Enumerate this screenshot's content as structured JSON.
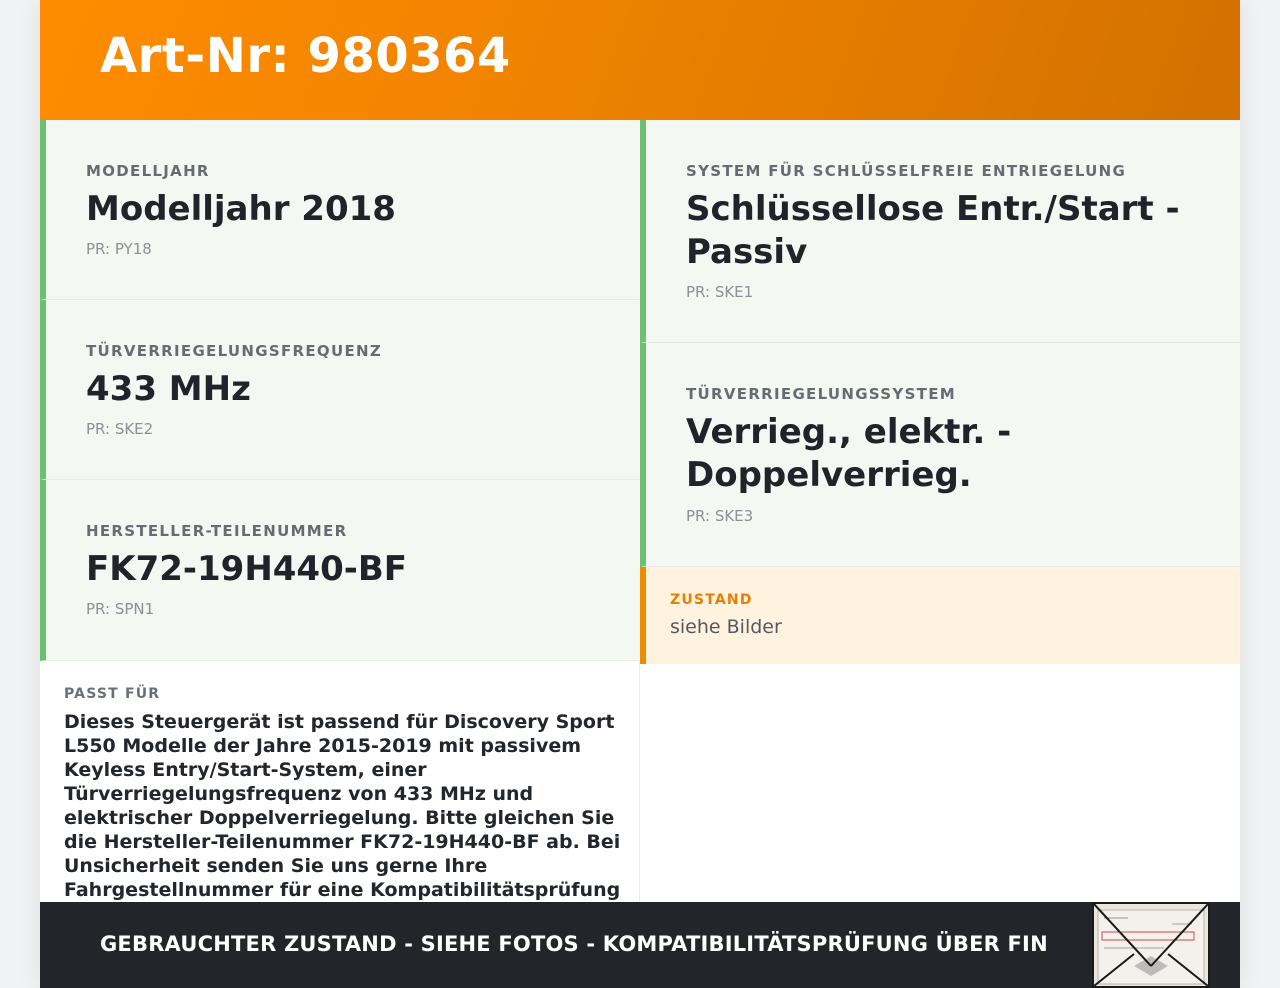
{
  "header": {
    "title": "Art-Nr: 980364"
  },
  "specs_left": [
    {
      "label": "Modelljahr",
      "value": "Modelljahr 2018",
      "pr": "PR: PY18"
    },
    {
      "label": "Türverriegelungsfrequenz",
      "value": "433 MHz",
      "pr": "PR: SKE2"
    },
    {
      "label": "Hersteller-Teilenummer",
      "value": "FK72-19H440-BF",
      "pr": "PR: SPN1"
    }
  ],
  "specs_right": [
    {
      "label": "System für schlüsselfreie Entriegelung",
      "value": "Schlüssellose Entr./Start - Passiv",
      "pr": "PR: SKE1"
    },
    {
      "label": "Türverriegelungssystem",
      "value": "Verrieg., elektr. - Doppelverrieg.",
      "pr": "PR: SKE3"
    }
  ],
  "condition": {
    "label": "Zustand",
    "value": "siehe Bilder"
  },
  "fits": {
    "label": "Passt für",
    "text": "Dieses Steuergerät ist passend für Discovery Sport L550 Modelle der Jahre 2015-2019 mit passivem Keyless Entry/Start-System, einer Türverriegelungsfrequenz von 433 MHz und elektrischer Doppelverriegelung. Bitte gleichen Sie die Hersteller-Teilenummer FK72-19H440-BF ab. Bei Unsicherheit senden Sie uns gerne Ihre Fahrgestellnummer für eine Kompatibilitätsprüfung zu."
  },
  "footer": {
    "note": "Gebrauchter Zustand - siehe Fotos - Kompatibilitätsprüfung über FIN"
  },
  "colors": {
    "header_orange": "#ff8c00",
    "accent_green": "#6cc070",
    "condition_orange": "#f08a00",
    "footer_dark": "#23252a"
  }
}
